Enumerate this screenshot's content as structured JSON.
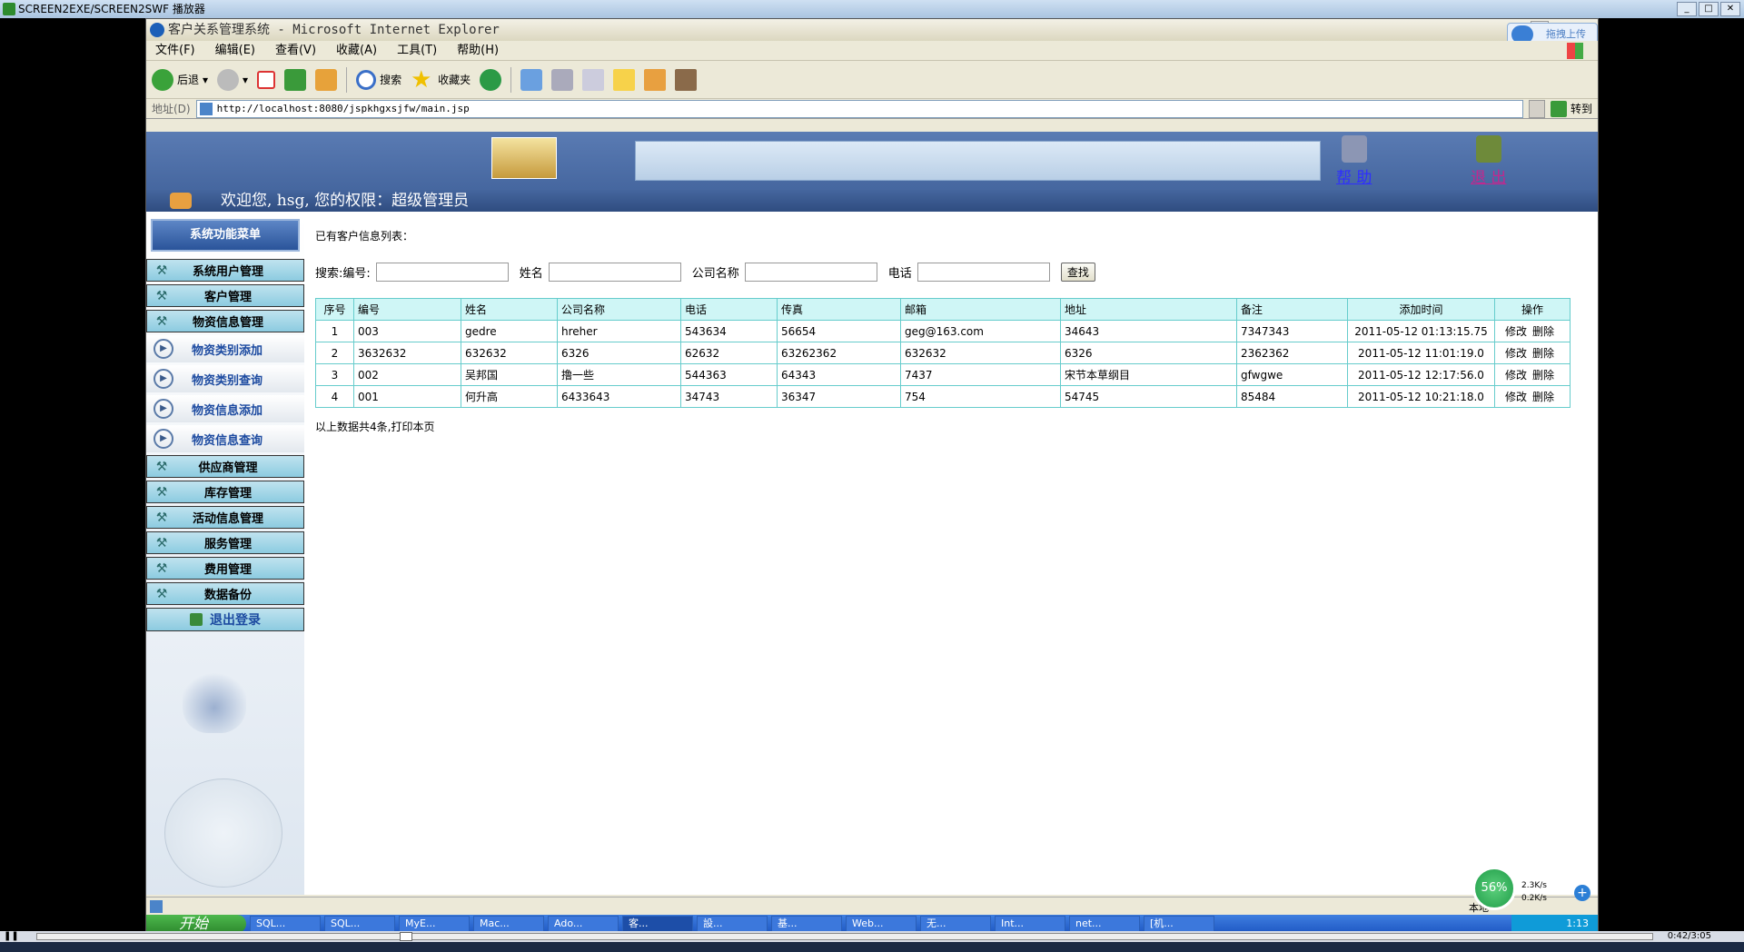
{
  "player": {
    "title": "SCREEN2EXE/SCREEN2SWF 播放器",
    "time": "0:42/3:05"
  },
  "ie": {
    "title": "客户关系管理系统 - Microsoft Internet Explorer",
    "upload_label": "拖拽上传",
    "menu": [
      "文件(F)",
      "编辑(E)",
      "查看(V)",
      "收藏(A)",
      "工具(T)",
      "帮助(H)"
    ],
    "toolbar": {
      "back": "后退",
      "search": "搜索",
      "favorites": "收藏夹"
    },
    "address_label": "地址(D)",
    "url": "http://localhost:8080/jspkhgxsjfw/main.jsp",
    "go_label": "转到"
  },
  "banner": {
    "help": "帮 助",
    "logout": "退 出",
    "welcome": "欢迎您, hsg, 您的权限：超级管理员"
  },
  "sidebar": {
    "title": "系统功能菜单",
    "items_top": [
      "系统用户管理",
      "客户管理",
      "物资信息管理"
    ],
    "sub_items": [
      "物资类别添加",
      "物资类别查询",
      "物资信息添加",
      "物资信息查询"
    ],
    "items_bottom": [
      "供应商管理",
      "库存管理",
      "活动信息管理",
      "服务管理",
      "费用管理",
      "数据备份"
    ],
    "logout": "退出登录"
  },
  "main": {
    "caption": "已有客户信息列表：",
    "search": {
      "label_id": "搜索:编号:",
      "label_name": "姓名",
      "label_company": "公司名称",
      "label_phone": "电话",
      "button": "查找"
    },
    "table": {
      "headers": [
        "序号",
        "编号",
        "姓名",
        "公司名称",
        "电话",
        "传真",
        "邮箱",
        "地址",
        "备注",
        "添加时间",
        "操作"
      ],
      "rows": [
        [
          "1",
          "003",
          "gedre",
          "hreher",
          "543634",
          "56654",
          "geg@163.com",
          "34643",
          "7347343",
          "2011-05-12 01:13:15.75"
        ],
        [
          "2",
          "3632632",
          "632632",
          "6326",
          "62632",
          "63262362",
          "632632",
          "6326",
          "2362362",
          "2011-05-12 11:01:19.0"
        ],
        [
          "3",
          "002",
          "吴邦国",
          "撸一些",
          "544363",
          "64343",
          "7437",
          "宋节本草纲目",
          "gfwgwe",
          "2011-05-12 12:17:56.0"
        ],
        [
          "4",
          "001",
          "何升高",
          "6433643",
          "34743",
          "36347",
          "754",
          "54745",
          "85484",
          "2011-05-12 10:21:18.0"
        ]
      ],
      "op_edit": "修改",
      "op_delete": "删除"
    },
    "footer_prefix": "以上数据共4条,",
    "footer_print": "打印本页"
  },
  "status": {
    "zone": "本地",
    "speed_pct": "56%",
    "up": "2.3K/s",
    "down": "0.2K/s"
  },
  "taskbar": {
    "start": "开始",
    "tasks": [
      "SQL...",
      "SQL...",
      "MyE...",
      "Mac...",
      "Ado...",
      "客...",
      "設...",
      "基...",
      "Web...",
      "无...",
      "Int...",
      "net...",
      "[机..."
    ],
    "active_index": 5,
    "clock": "1:13"
  }
}
